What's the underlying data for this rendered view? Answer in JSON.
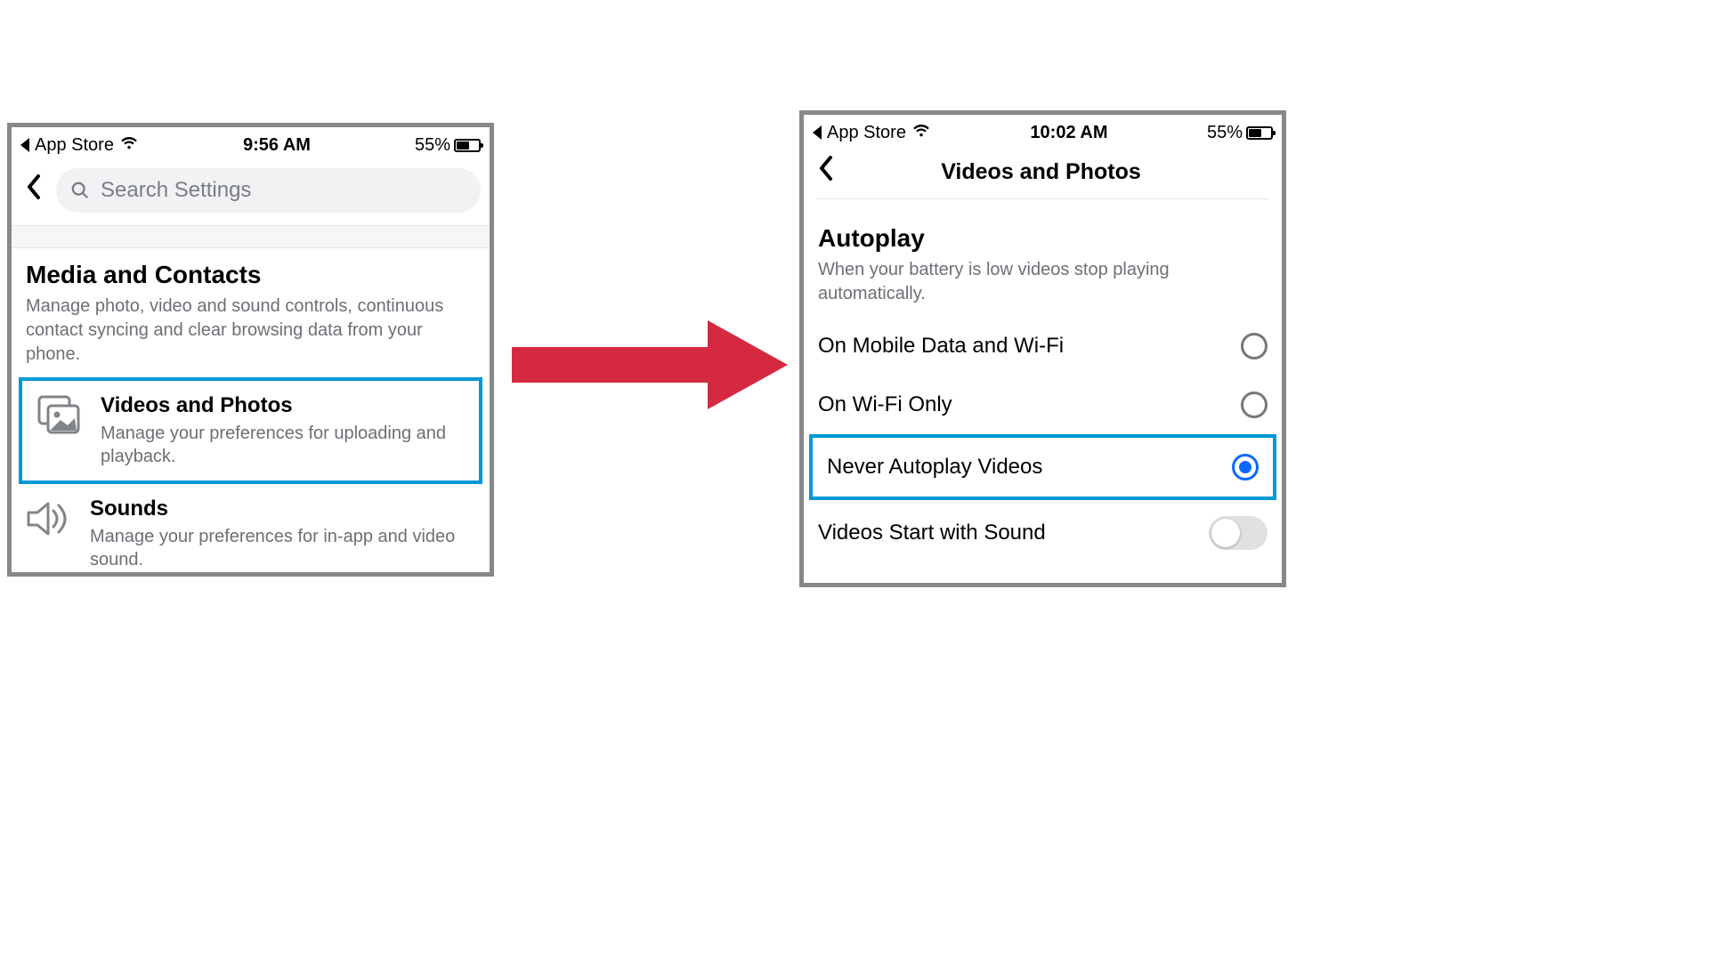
{
  "left": {
    "status": {
      "back_app": "App Store",
      "time": "9:56 AM",
      "battery_pct": "55%"
    },
    "search_placeholder": "Search Settings",
    "section": {
      "title": "Media and Contacts",
      "desc": "Manage photo, video and sound controls, continuous contact syncing and clear browsing data from your phone."
    },
    "rows": {
      "videos_title": "Videos and Photos",
      "videos_desc": "Manage your preferences for uploading and playback.",
      "sounds_title": "Sounds",
      "sounds_desc": "Manage your preferences for in-app and video sound."
    }
  },
  "right": {
    "status": {
      "back_app": "App Store",
      "time": "10:02 AM",
      "battery_pct": "55%"
    },
    "page_title": "Videos and Photos",
    "autoplay": {
      "title": "Autoplay",
      "desc": "When your battery is low videos stop playing automatically.",
      "option1": "On Mobile Data and Wi-Fi",
      "option2": "On Wi-Fi Only",
      "option3": "Never Autoplay Videos",
      "selected_index": 2
    },
    "sound_toggle": {
      "label": "Videos Start with Sound",
      "on": false
    }
  }
}
